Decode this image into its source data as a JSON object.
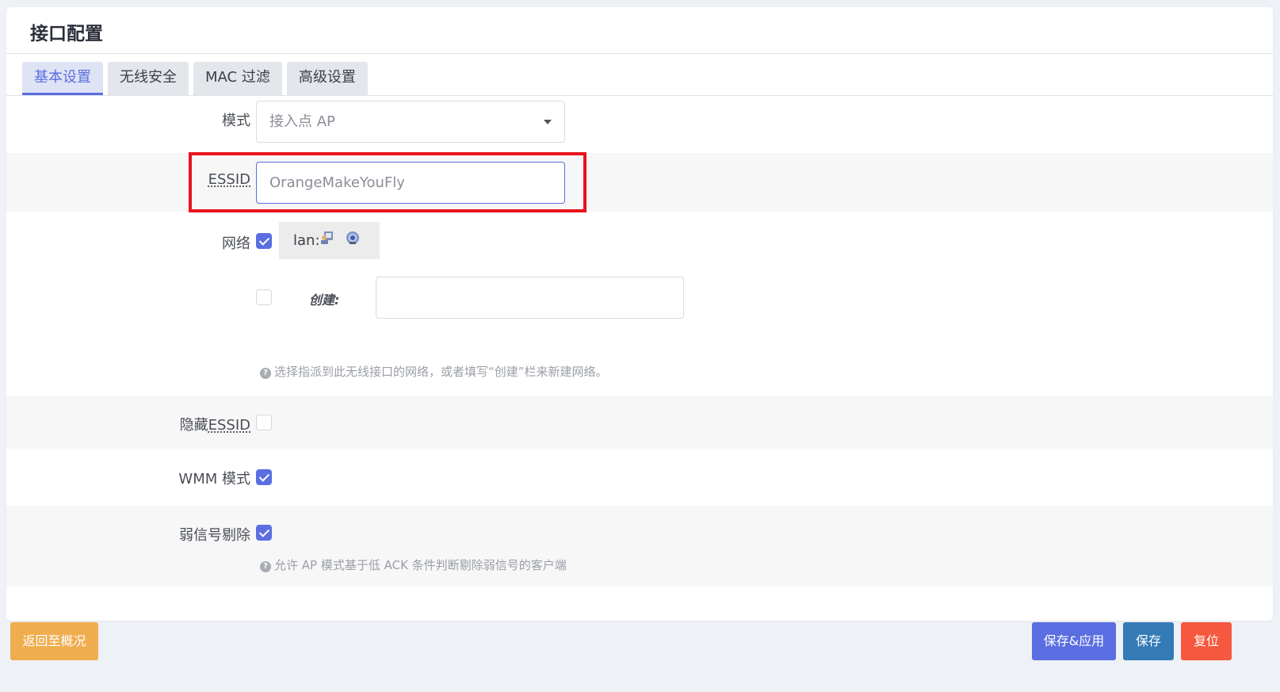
{
  "page": {
    "title": "接口配置"
  },
  "tabs": [
    {
      "label": "基本设置",
      "active": true
    },
    {
      "label": "无线安全",
      "active": false
    },
    {
      "label": "MAC 过滤",
      "active": false
    },
    {
      "label": "高级设置",
      "active": false
    }
  ],
  "form": {
    "mode": {
      "label": "模式",
      "value": "接入点 AP"
    },
    "essid": {
      "label": "ESSID",
      "value": "OrangeMakeYouFly"
    },
    "network": {
      "label": "网络",
      "lan_checked": true,
      "lan_label": "lan:",
      "create_checked": false,
      "create_label": "创建:",
      "create_value": "",
      "hint": "选择指派到此无线接口的网络，或者填写“创建”栏来新建网络。"
    },
    "hide_essid": {
      "label_prefix": "隐藏",
      "label_essid": "ESSID",
      "checked": false
    },
    "wmm": {
      "label": "WMM 模式",
      "checked": true
    },
    "weak_signal": {
      "label": "弱信号剔除",
      "checked": true,
      "hint": "允许 AP 模式基于低 ACK 条件判断剔除弱信号的客户端"
    }
  },
  "actions": {
    "back": "返回至概况",
    "save_apply": "保存&应用",
    "save": "保存",
    "reset": "复位"
  },
  "colors": {
    "accent": "#5b6ee1",
    "back_button": "#f0ad4e",
    "save_apply_button": "#5b6ee1",
    "save_button": "#337ab7",
    "reset_button": "#f5583e",
    "highlight_box": "#e8141c"
  },
  "icons": {
    "network_icon_1": "ethernet-bridge-icon",
    "network_icon_2": "wifi-icon",
    "hint_icon": "help-circle-icon",
    "select_caret": "chevron-down-icon"
  }
}
